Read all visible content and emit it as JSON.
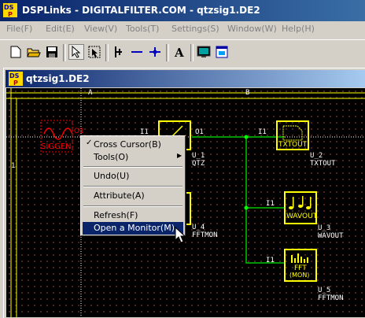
{
  "window": {
    "title": "DSPLinks - DIGITALFILTER.COM - qtzsig1.DE2"
  },
  "menubar": {
    "items": [
      "File(F)",
      "Edit(E)",
      "View(V)",
      "Tools(T)",
      "Settings(S)",
      "Window(W)",
      "Help(H)"
    ]
  },
  "child": {
    "title": "qtzsig1.DE2"
  },
  "ruler": {
    "col_a": "A",
    "col_b": "B",
    "row_1": "1"
  },
  "blocks": {
    "siggen": {
      "name": "SIGGEN",
      "port": "O1"
    },
    "qtz": {
      "in": "I1",
      "out": "O1",
      "id": "U_1",
      "name": "QTZ"
    },
    "fftmon4": {
      "id": "U_4",
      "name": "FFTMON"
    },
    "txtout": {
      "in": "I1",
      "icon_text": "TXTOUT",
      "id": "U_2",
      "name": "TXTOUT"
    },
    "wavout": {
      "in": "I1",
      "icon_text": "WAVOUT",
      "id": "U_3",
      "name": "WAVOUT"
    },
    "fftmon5": {
      "in": "I1",
      "icon_text1": "FFT",
      "icon_text2": "(MON)",
      "id": "U_5",
      "name": "FFTMON"
    }
  },
  "context_menu": {
    "items": [
      "Cross Cursor(B)",
      "Tools(O)",
      "Undo(U)",
      "Attribute(A)",
      "Refresh(F)",
      "Open a Monitor(M)"
    ],
    "checked": "Cross Cursor(B)",
    "highlighted": "Open a Monitor(M)"
  },
  "colors": {
    "title_start": "#0a246a",
    "wire": "#00c800",
    "block_yellow": "#ffff00",
    "siggen_red": "#ff0000"
  }
}
